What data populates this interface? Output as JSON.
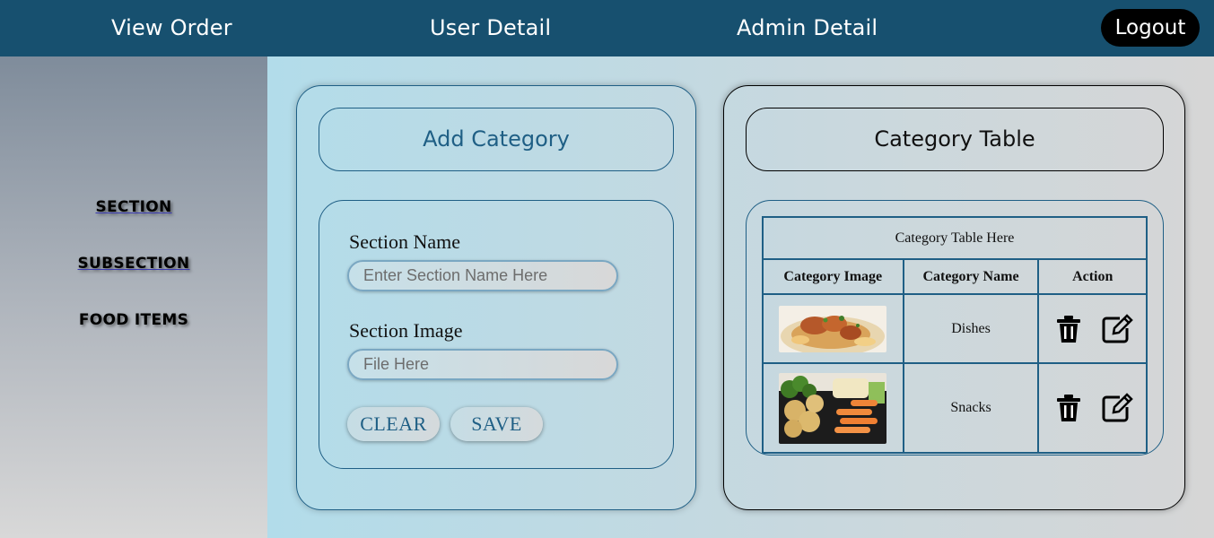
{
  "nav": {
    "view_order": "View Order",
    "user_detail": "User Detail",
    "admin_detail": "Admin Detail",
    "logout": "Logout"
  },
  "sidebar": {
    "items": [
      {
        "label": "SECTION"
      },
      {
        "label": "SUBSECTION"
      },
      {
        "label": "FOOD ITEMS"
      }
    ]
  },
  "form": {
    "title": "Add Category",
    "section_name_label": "Section Name",
    "section_name_placeholder": "Enter Section Name Here",
    "section_image_label": "Section Image",
    "section_image_placeholder": "File Here",
    "clear_label": "CLEAR",
    "save_label": "SAVE"
  },
  "table": {
    "title": "Category Table",
    "caption": "Category Table Here",
    "columns": [
      "Category Image",
      "Category Name",
      "Action"
    ],
    "rows": [
      {
        "name": "Dishes",
        "image": "biryani-dish-photo",
        "actions": [
          "trash-icon",
          "edit-icon"
        ]
      },
      {
        "name": "Snacks",
        "image": "snack-platter-photo",
        "actions": [
          "trash-icon",
          "edit-icon"
        ]
      }
    ]
  },
  "colors": {
    "topbar": "#17506f",
    "accent": "#1f5f85",
    "logout_bg": "#000000"
  }
}
